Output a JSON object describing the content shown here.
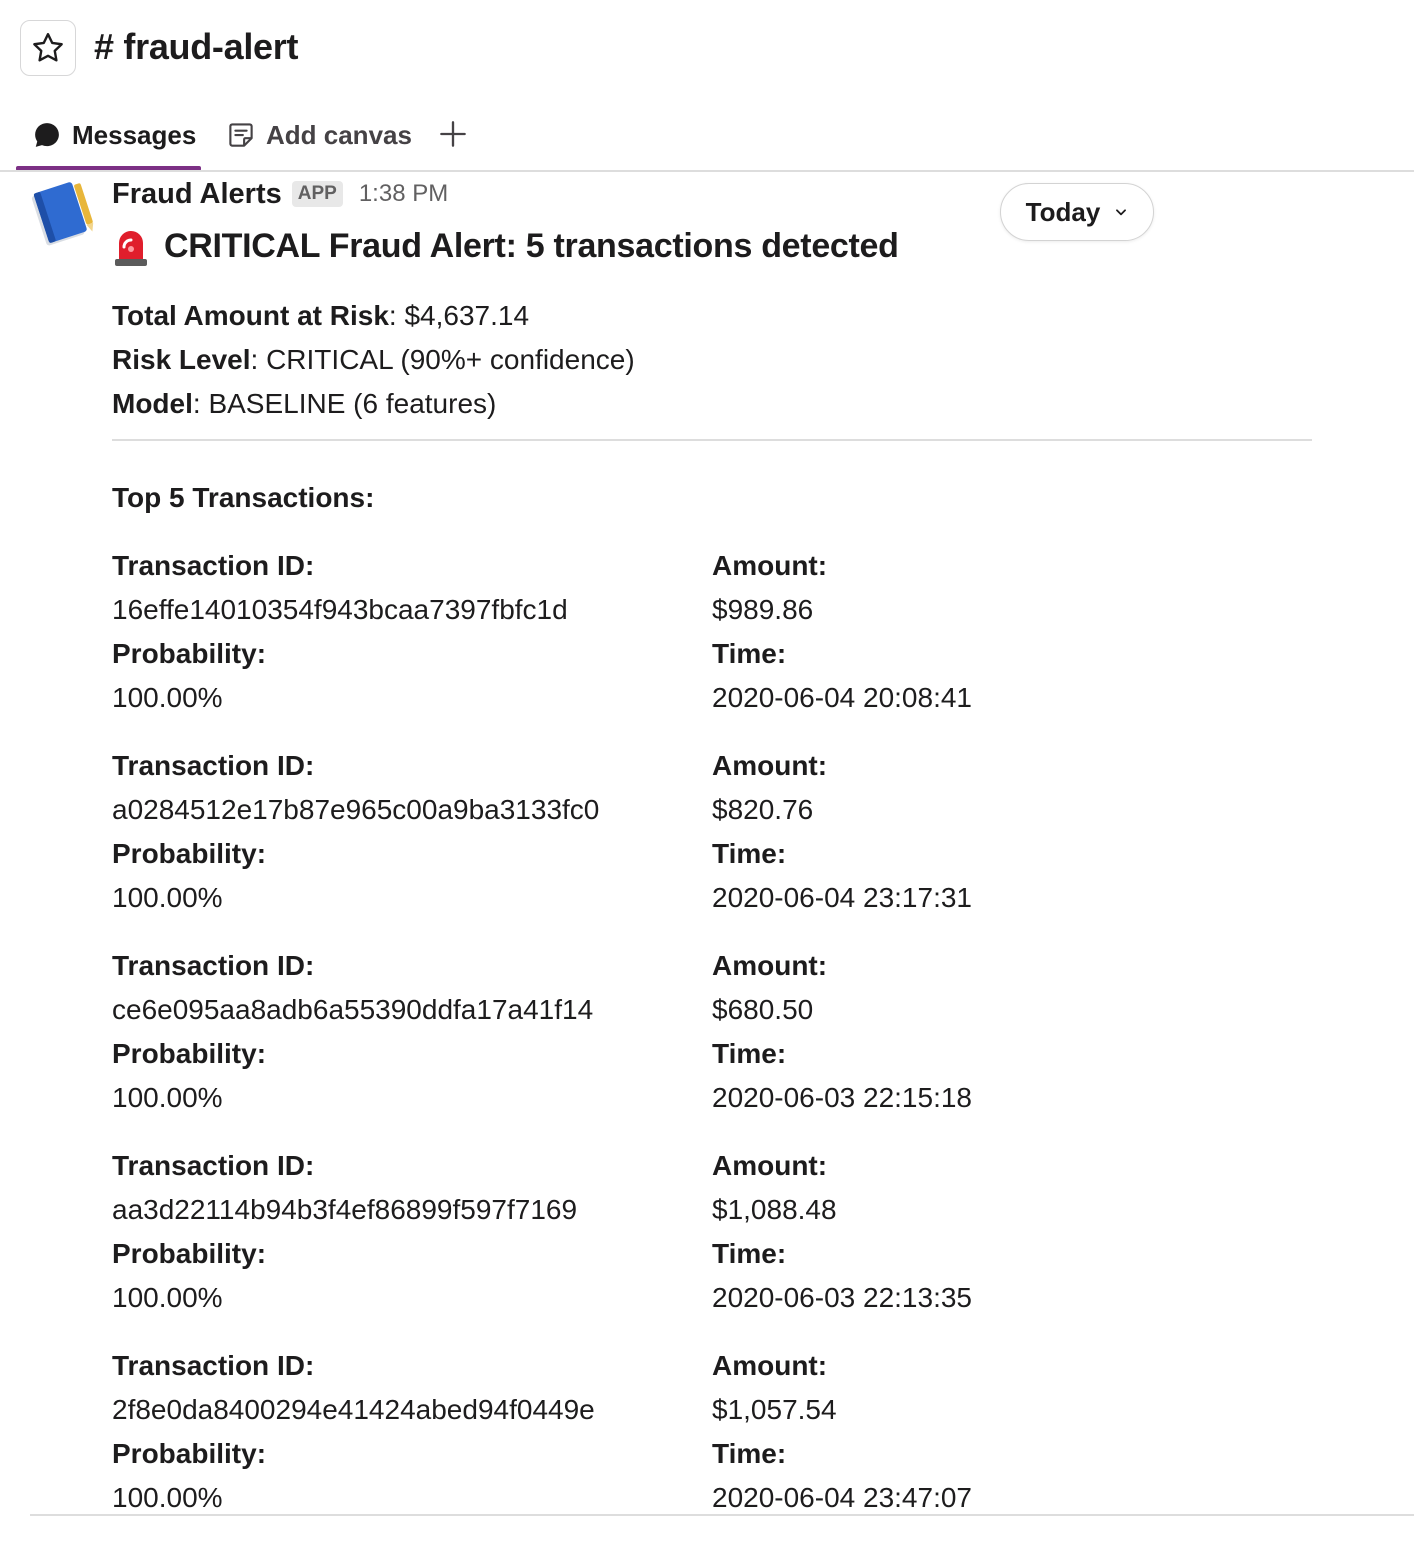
{
  "channel": {
    "name": "# fraud-alert"
  },
  "tabs": [
    {
      "label": "Messages",
      "icon": "chat-bubble-icon",
      "active": true
    },
    {
      "label": "Add canvas",
      "icon": "canvas-icon",
      "active": false
    }
  ],
  "date_pill": {
    "label": "Today"
  },
  "message": {
    "sender": "Fraud Alerts",
    "badge": "APP",
    "time": "1:38 PM",
    "title": "CRITICAL Fraud Alert: 5 transactions detected",
    "title_icon": "siren-icon",
    "summary": [
      {
        "label": "Total Amount at Risk",
        "value": ": $4,637.14"
      },
      {
        "label": "Risk Level",
        "value": ": CRITICAL (90%+ confidence)"
      },
      {
        "label": "Model",
        "value": ": BASELINE (6 features)"
      }
    ],
    "section_heading": "Top 5 Transactions:",
    "field_labels": {
      "id": "Transaction ID:",
      "amount": "Amount:",
      "probability": "Probability:",
      "time": "Time:"
    },
    "transactions": [
      {
        "id": "16effe14010354f943bcaa7397fbfc1d",
        "amount": "$989.86",
        "probability": "100.00%",
        "time": "2020-06-04 20:08:41"
      },
      {
        "id": "a0284512e17b87e965c00a9ba3133fc0",
        "amount": "$820.76",
        "probability": "100.00%",
        "time": "2020-06-04 23:17:31"
      },
      {
        "id": "ce6e095aa8adb6a55390ddfa17a41f14",
        "amount": "$680.50",
        "probability": "100.00%",
        "time": "2020-06-03 22:15:18"
      },
      {
        "id": "aa3d22114b94b3f4ef86899f597f7169",
        "amount": "$1,088.48",
        "probability": "100.00%",
        "time": "2020-06-03 22:13:35"
      },
      {
        "id": "2f8e0da8400294e41424abed94f0449e",
        "amount": "$1,057.54",
        "probability": "100.00%",
        "time": "2020-06-04 23:47:07"
      }
    ]
  },
  "colors": {
    "tab_accent": "#7c3085",
    "siren_red": "#e01e2c",
    "avatar_blue": "#2f6bd1"
  }
}
